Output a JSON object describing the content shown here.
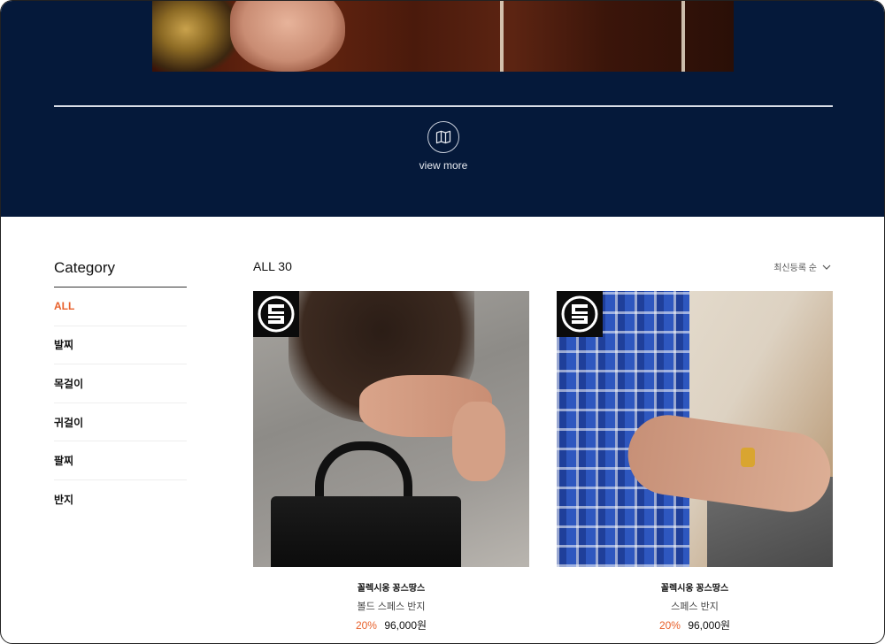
{
  "hero": {
    "view_more": "view more",
    "map_icon": "map-icon"
  },
  "sidebar": {
    "title": "Category",
    "items": [
      {
        "label": "ALL",
        "active": true
      },
      {
        "label": "발찌",
        "active": false
      },
      {
        "label": "목걸이",
        "active": false
      },
      {
        "label": "귀걸이",
        "active": false
      },
      {
        "label": "팔찌",
        "active": false
      },
      {
        "label": "반지",
        "active": false
      }
    ]
  },
  "products": {
    "count_label": "ALL 30",
    "sort_label": "최신등록 순",
    "sort_icon": "chevron-down-icon",
    "items": [
      {
        "brand": "꼴렉시옹 꽁스땅스",
        "name": "볼드 스페스 반지",
        "discount": "20%",
        "price": "96,000원"
      },
      {
        "brand": "꼴렉시옹 꽁스땅스",
        "name": "스페스 반지",
        "discount": "20%",
        "price": "96,000원"
      }
    ]
  },
  "colors": {
    "hero_bg": "#05193a",
    "accent": "#e8612c"
  }
}
